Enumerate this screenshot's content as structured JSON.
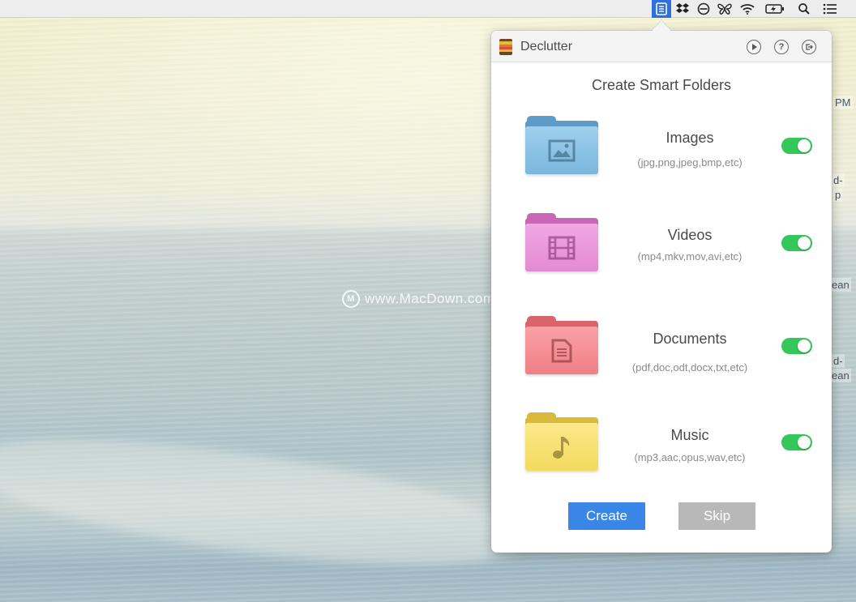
{
  "desktop": {
    "watermark": "www.MacDown.com",
    "peek_texts": [
      "PM",
      "d-",
      "p",
      "ean",
      "d-",
      "ean"
    ]
  },
  "menubar": {
    "icons": [
      "declutter-icon",
      "dropbox-icon",
      "do-not-disturb-icon",
      "butterfly-icon",
      "wifi-icon",
      "battery-charging-icon",
      "spotlight-search-icon",
      "notification-center-icon"
    ]
  },
  "popover": {
    "app_title": "Declutter",
    "header_buttons": [
      "play-icon",
      "help-icon",
      "exit-icon"
    ],
    "subtitle": "Create Smart Folders",
    "categories": [
      {
        "name": "Images",
        "extensions": "(jpg,png,jpeg,bmp,etc)",
        "enabled": true,
        "icon": "image-folder-icon",
        "color": "#7ab6dc"
      },
      {
        "name": "Videos",
        "extensions": "(mp4,mkv,mov,avi,etc)",
        "enabled": true,
        "icon": "video-folder-icon",
        "color": "#e48ad4"
      },
      {
        "name": "Documents",
        "extensions": "(pdf,doc,odt,docx,txt,etc)",
        "enabled": true,
        "icon": "document-folder-icon",
        "color": "#f07f86"
      },
      {
        "name": "Music",
        "extensions": "(mp3,aac,opus,wav,etc)",
        "enabled": true,
        "icon": "music-folder-icon",
        "color": "#f4da5e"
      }
    ],
    "create_label": "Create",
    "skip_label": "Skip"
  },
  "colors": {
    "toggle_on": "#34c759",
    "create_button": "#3a86e6",
    "skip_button": "#b8b8b8",
    "menubar_highlight": "#2f6fe0"
  }
}
